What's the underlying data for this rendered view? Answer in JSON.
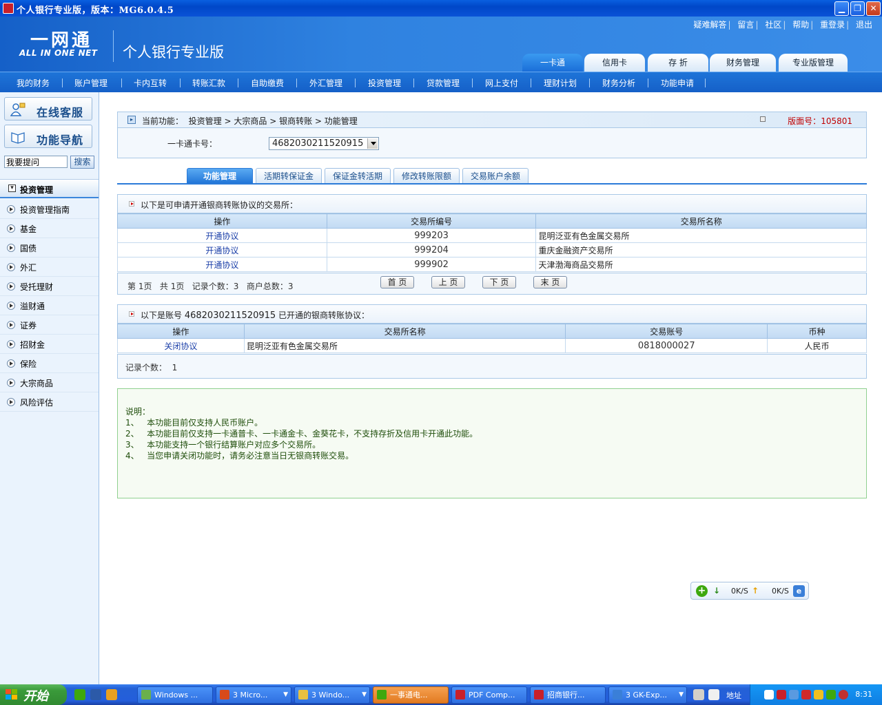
{
  "window": {
    "title": "个人银行专业版，版本：MG6.0.4.5",
    "min_symbol": "▁",
    "max_symbol": "❐",
    "close_symbol": "✕"
  },
  "header": {
    "logo_main": "一网通",
    "logo_sub": "ALL IN ONE NET",
    "product_name": "个人银行专业版",
    "top_links": [
      "疑难解答",
      "留言",
      "社区",
      "帮助",
      "重登录",
      "退出"
    ],
    "top_link_sep": "|",
    "main_tabs": [
      {
        "label": "一卡通",
        "active": true
      },
      {
        "label": "信用卡",
        "active": false
      },
      {
        "label": "存  折",
        "active": false
      },
      {
        "label": "财务管理",
        "active": false
      },
      {
        "label": "专业版管理",
        "active": false
      }
    ]
  },
  "nav": {
    "items": [
      "我的财务",
      "账户管理",
      "卡内互转",
      "转账汇款",
      "自助缴费",
      "外汇管理",
      "投资管理",
      "贷款管理",
      "网上支付",
      "理财计划",
      "财务分析",
      "功能申请"
    ]
  },
  "sidebar": {
    "online_service": "在线客服",
    "function_nav": "功能导航",
    "ask_placeholder": "我要提问",
    "search_label": "搜索",
    "section_title": "投资管理",
    "items": [
      "投资管理指南",
      "基金",
      "国债",
      "外汇",
      "受托理财",
      "溢财通",
      "证券",
      "招财金",
      "保险",
      "大宗商品",
      "风险评估"
    ]
  },
  "breadcrumb": {
    "prefix": "当前功能：",
    "path": [
      "投资管理",
      "大宗商品",
      "银商转账",
      "功能管理"
    ],
    "version_label": "版面号：",
    "version_no": "105801"
  },
  "card": {
    "label": "一卡通卡号：",
    "selected": "4682030211520915"
  },
  "subtabs": [
    {
      "label": "功能管理",
      "active": true
    },
    {
      "label": "活期转保证金",
      "active": false
    },
    {
      "label": "保证金转活期",
      "active": false
    },
    {
      "label": "修改转账限额",
      "active": false
    },
    {
      "label": "交易账户余额",
      "active": false
    }
  ],
  "available": {
    "heading": "以下是可申请开通银商转账协议的交易所：",
    "columns": [
      "操作",
      "交易所编号",
      "交易所名称"
    ],
    "rows": [
      {
        "action": "开通协议",
        "code": "999203",
        "name": "昆明泛亚有色金属交易所"
      },
      {
        "action": "开通协议",
        "code": "999204",
        "name": "重庆金融资产交易所"
      },
      {
        "action": "开通协议",
        "code": "999902",
        "name": "天津渤海商品交易所"
      }
    ],
    "pager": {
      "info": "第 1页   共 1页   记录个数：3   商户总数：3",
      "first": "首 页",
      "prev": "上 页",
      "next": "下 页",
      "last": "末 页"
    }
  },
  "opened": {
    "heading_prefix": "以下是账号",
    "account": "4682030211520915",
    "heading_suffix": "已开通的银商转账协议：",
    "columns": [
      "操作",
      "交易所名称",
      "交易账号",
      "币种"
    ],
    "rows": [
      {
        "action": "关闭协议",
        "name": "昆明泛亚有色金属交易所",
        "account_no": "0818000027",
        "currency": "人民币"
      }
    ],
    "count": "记录个数：  1"
  },
  "notes": {
    "title": "说明：",
    "lines": [
      "1、   本功能目前仅支持人民币账户。",
      "2、   本功能目前仅支持一卡通普卡、一卡通金卡、金葵花卡，不支持存折及信用卡开通此功能。",
      "3、   本功能支持一个银行结算账户对应多个交易所。",
      "4、   当您申请关闭功能时，请务必注意当日无银商转账交易。"
    ]
  },
  "speed_widget": {
    "down_value": "0K/S",
    "up_value": "0K/S"
  },
  "taskbar": {
    "start_label": "开始",
    "tasks": [
      {
        "label": "Windows ...",
        "color": "#6ab04c",
        "active": false,
        "has_drop": false
      },
      {
        "label": "3 Micro...",
        "color": "#d84a1a",
        "active": false,
        "has_drop": true
      },
      {
        "label": "3 Windo...",
        "color": "#e8c040",
        "active": false,
        "has_drop": true
      },
      {
        "label": "一事通电...",
        "color": "#3ea80e",
        "active": true,
        "has_drop": false
      },
      {
        "label": "PDF Comp...",
        "color": "#c8202a",
        "active": false,
        "has_drop": false
      },
      {
        "label": "招商银行...",
        "color": "#c8202a",
        "active": false,
        "has_drop": false
      },
      {
        "label": "3 GK-Exp...",
        "color": "#3a7fd8",
        "active": false,
        "has_drop": true
      }
    ],
    "address_label": "地址",
    "clock": "8:31"
  },
  "colors": {
    "brand_blue": "#1560c8",
    "version_red": "#c00000",
    "link_blue": "#1b3fa8",
    "notes_green": "#1e4d0a"
  }
}
